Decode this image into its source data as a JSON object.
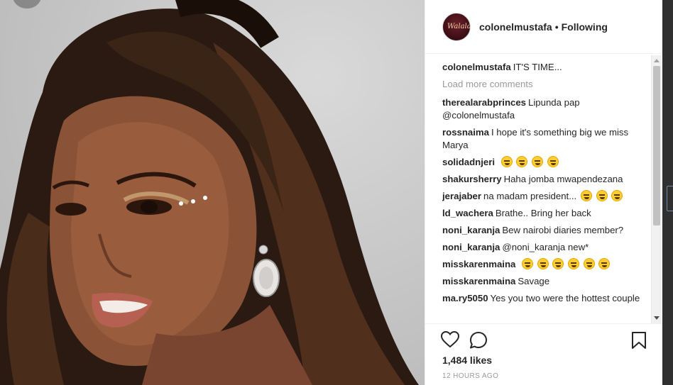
{
  "post": {
    "username": "colonelmustafa",
    "separator": "•",
    "follow_status": "Following",
    "avatar_text": "Walala",
    "likes": "1,484 likes",
    "time": "12 HOURS AGO"
  },
  "comments": {
    "caption": {
      "user": "colonelmustafa",
      "text": "IT'S TIME..."
    },
    "load_more": "Load more comments",
    "items": [
      {
        "user": "therealarabprinces",
        "text": "Lipunda pap @colonelmustafa"
      },
      {
        "user": "rossnaima",
        "text": "I hope it's something big we miss Marya"
      },
      {
        "user": "solidadnjeri",
        "text": "",
        "emojis": [
          "thinking-emoji",
          "laughing-emoji",
          "laughing-emoji",
          "laughing-emoji"
        ]
      },
      {
        "user": "shakursherry",
        "text": "Haha jomba mwapendezana"
      },
      {
        "user": "jerajaber",
        "text": "na madam president...",
        "emojis": [
          "neutral-emoji",
          "neutral-emoji",
          "neutral-emoji"
        ]
      },
      {
        "user": "ld_wachera",
        "text": "Brathe.. Bring her back"
      },
      {
        "user": "noni_karanja",
        "text": "Bew nairobi diaries member?"
      },
      {
        "user": "noni_karanja",
        "text": "@noni_karanja new*"
      },
      {
        "user": "misskarenmaina",
        "text": "",
        "emojis": [
          "laughing-emoji",
          "laughing-emoji",
          "laughing-emoji",
          "laughing-emoji",
          "laughing-emoji",
          "laughing-emoji"
        ]
      },
      {
        "user": "misskarenmaina",
        "text": "Savage"
      },
      {
        "user": "ma.ry5050",
        "text": "Yes you two were the hottest couple"
      }
    ]
  },
  "icons": {
    "like": "heart-icon",
    "comment": "comment-bubble-icon",
    "save": "bookmark-icon"
  },
  "colors": {
    "text": "#262626",
    "muted": "#999999",
    "emoji": "#ffcc33"
  }
}
